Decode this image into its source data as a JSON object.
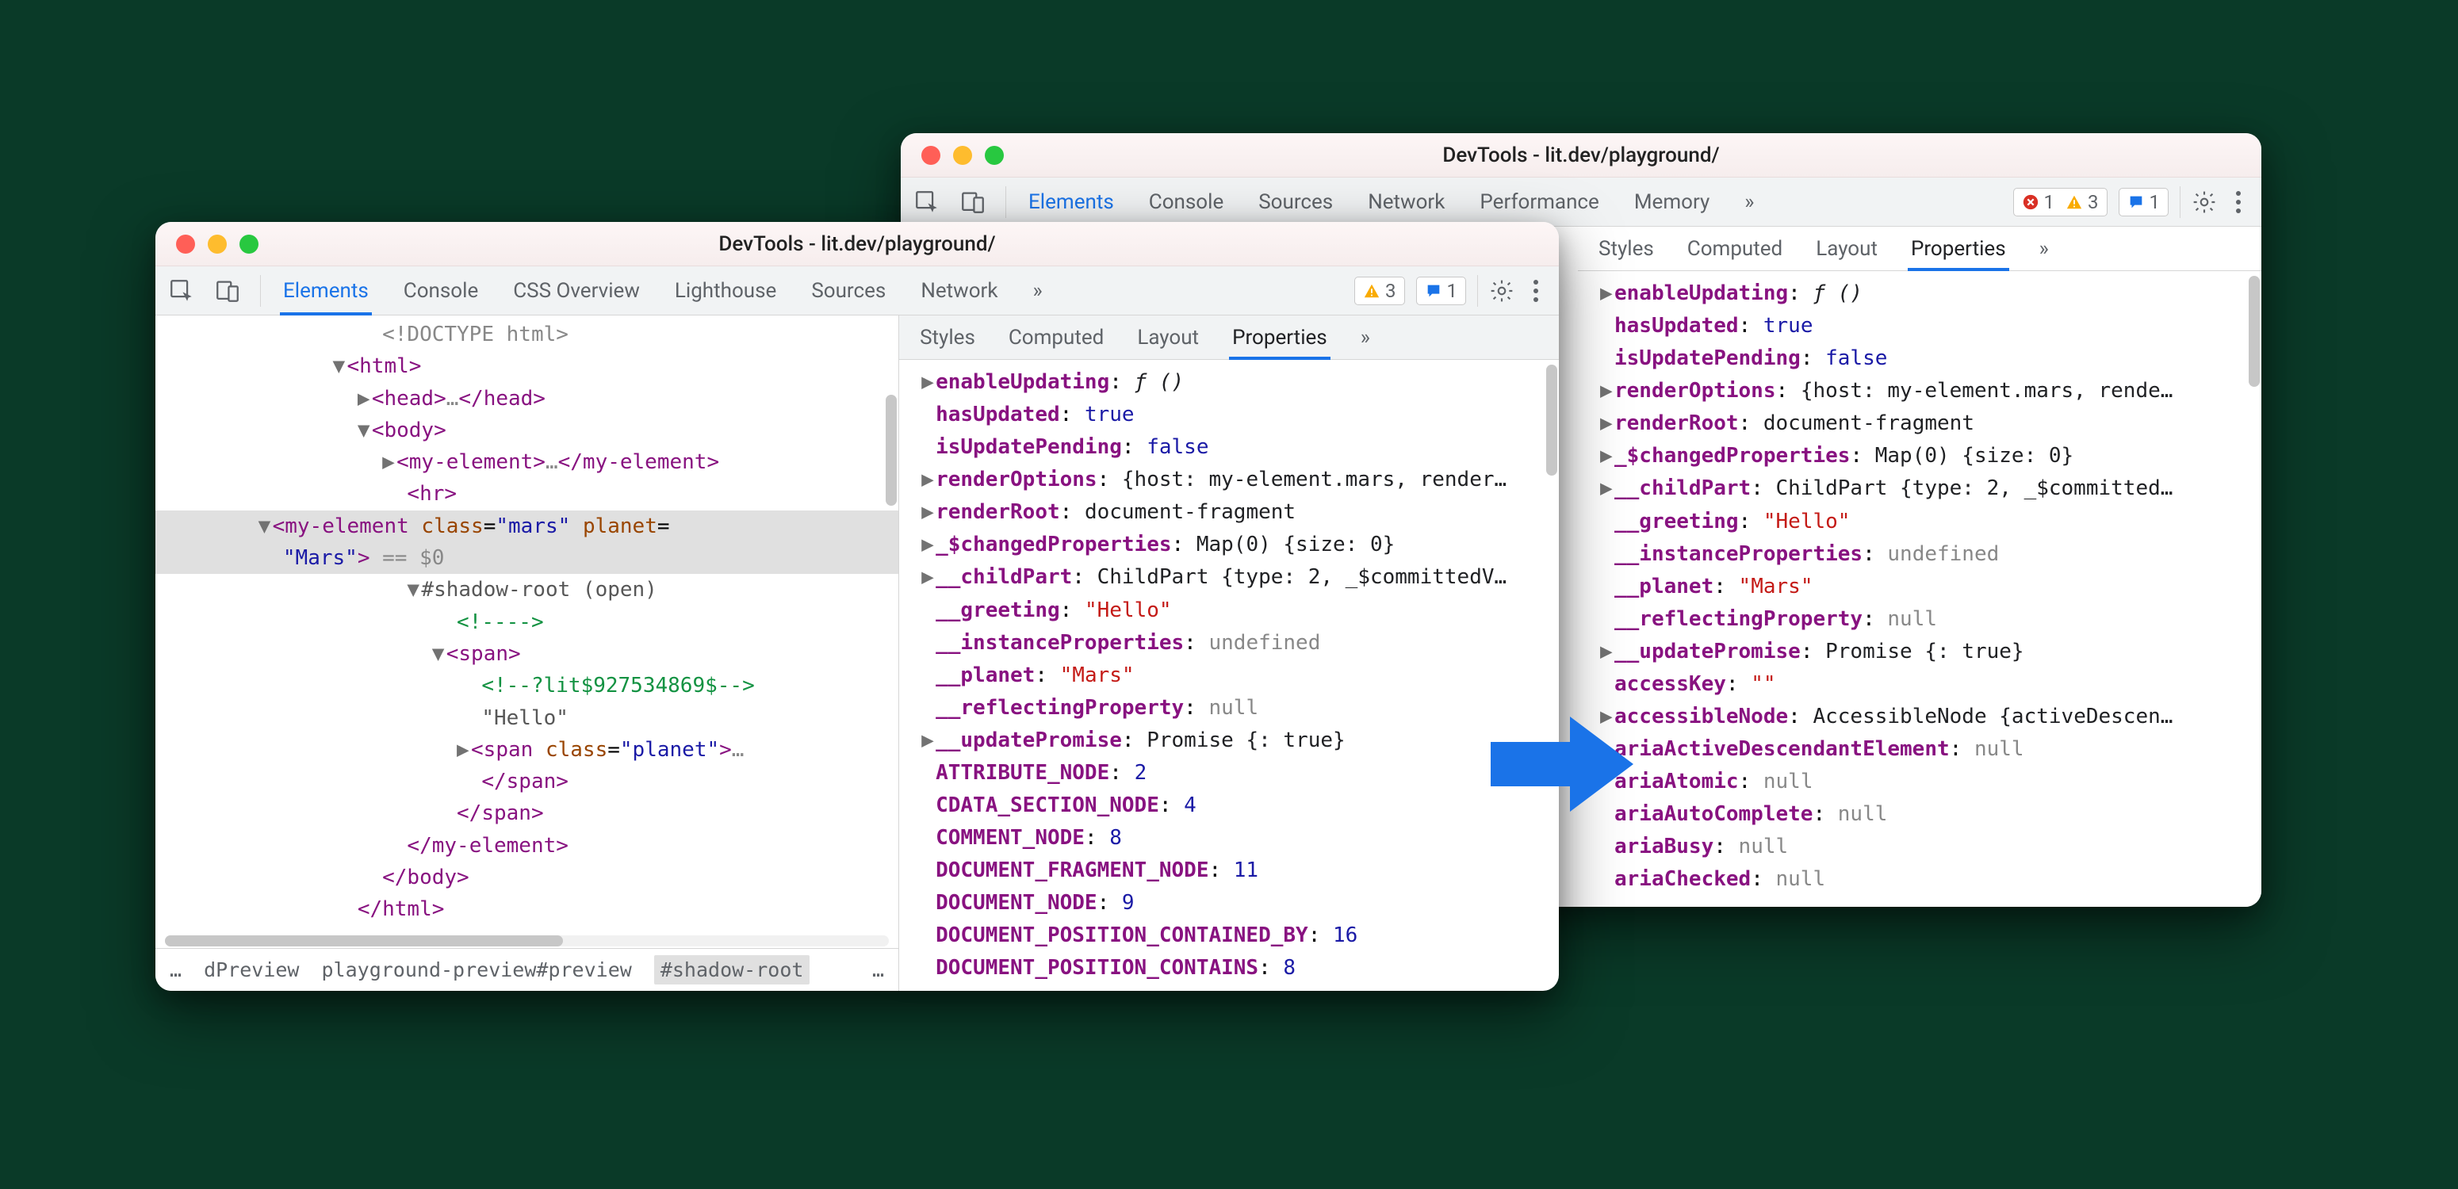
{
  "windowA": {
    "title": "DevTools - lit.dev/playground/",
    "tabs": [
      "Elements",
      "Console",
      "CSS Overview",
      "Lighthouse",
      "Sources",
      "Network"
    ],
    "activeTab": "Elements",
    "warnBadge": "3",
    "msgBadge": "1",
    "dom": {
      "doctype": "<!DOCTYPE html>",
      "html_open": "<html>",
      "head": "<head>…</head>",
      "body_open": "<body>",
      "myel_collapsed": "<my-element>…</my-element>",
      "hr": "<hr>",
      "sel_open_tag": "my-element",
      "sel_attr_class_name": "class",
      "sel_attr_class_val": "mars",
      "sel_attr_planet_name": "planet",
      "sel_attr_planet_val": "Mars",
      "sel_eq": " == $0",
      "shadow": "#shadow-root (open)",
      "lit_comment_1": "<!---->",
      "span_open": "<span>",
      "lit_comment_2": "<!--?lit$927534869$-->",
      "hello_text": "\"Hello\"",
      "span_planet": "<span class=\"planet\">…",
      "span_close": "</span>",
      "span_close_2": "</span>",
      "myel_close": "</my-element>",
      "body_close": "</body>",
      "html_close": "</html>"
    },
    "breadcrumb": {
      "a": "dPreview",
      "b": "playground-preview#preview",
      "c": "#shadow-root"
    },
    "subtabs": [
      "Styles",
      "Computed",
      "Layout",
      "Properties"
    ],
    "activeSubtab": "Properties",
    "props": [
      {
        "k": "enableUpdating",
        "v": "ƒ ()",
        "t": "fn",
        "tri": true
      },
      {
        "k": "hasUpdated",
        "v": "true",
        "t": "true"
      },
      {
        "k": "isUpdatePending",
        "v": "false",
        "t": "false"
      },
      {
        "k": "renderOptions",
        "v": "{host: my-element.mars, render…",
        "t": "obj",
        "tri": true
      },
      {
        "k": "renderRoot",
        "v": "document-fragment",
        "t": "obj",
        "tri": true
      },
      {
        "k": "_$changedProperties",
        "v": "Map(0) {size: 0}",
        "t": "obj",
        "tri": true
      },
      {
        "k": "__childPart",
        "v": "ChildPart {type: 2, _$committedV…",
        "t": "obj",
        "tri": true
      },
      {
        "k": "__greeting",
        "v": "\"Hello\"",
        "t": "str"
      },
      {
        "k": "__instanceProperties",
        "v": "undefined",
        "t": "undef"
      },
      {
        "k": "__planet",
        "v": "\"Mars\"",
        "t": "str"
      },
      {
        "k": "__reflectingProperty",
        "v": "null",
        "t": "null"
      },
      {
        "k": "__updatePromise",
        "v": "Promise {<fulfilled>: true}",
        "t": "obj",
        "tri": true
      },
      {
        "k": "ATTRIBUTE_NODE",
        "v": "2",
        "t": "num"
      },
      {
        "k": "CDATA_SECTION_NODE",
        "v": "4",
        "t": "num"
      },
      {
        "k": "COMMENT_NODE",
        "v": "8",
        "t": "num"
      },
      {
        "k": "DOCUMENT_FRAGMENT_NODE",
        "v": "11",
        "t": "num"
      },
      {
        "k": "DOCUMENT_NODE",
        "v": "9",
        "t": "num"
      },
      {
        "k": "DOCUMENT_POSITION_CONTAINED_BY",
        "v": "16",
        "t": "num"
      },
      {
        "k": "DOCUMENT_POSITION_CONTAINS",
        "v": "8",
        "t": "num"
      }
    ]
  },
  "windowB": {
    "title": "DevTools - lit.dev/playground/",
    "tabs": [
      "Elements",
      "Console",
      "Sources",
      "Network",
      "Performance",
      "Memory"
    ],
    "activeTab": "Elements",
    "errBadge": "1",
    "warnBadge": "3",
    "msgBadge": "1",
    "subtabs": [
      "Styles",
      "Computed",
      "Layout",
      "Properties"
    ],
    "activeSubtab": "Properties",
    "props": [
      {
        "k": "enableUpdating",
        "v": "ƒ ()",
        "t": "fn",
        "tri": true
      },
      {
        "k": "hasUpdated",
        "v": "true",
        "t": "true"
      },
      {
        "k": "isUpdatePending",
        "v": "false",
        "t": "false"
      },
      {
        "k": "renderOptions",
        "v": "{host: my-element.mars, rende…",
        "t": "obj",
        "tri": true
      },
      {
        "k": "renderRoot",
        "v": "document-fragment",
        "t": "obj",
        "tri": true
      },
      {
        "k": "_$changedProperties",
        "v": "Map(0) {size: 0}",
        "t": "obj",
        "tri": true
      },
      {
        "k": "__childPart",
        "v": "ChildPart {type: 2, _$committed…",
        "t": "obj",
        "tri": true
      },
      {
        "k": "__greeting",
        "v": "\"Hello\"",
        "t": "str"
      },
      {
        "k": "__instanceProperties",
        "v": "undefined",
        "t": "undef"
      },
      {
        "k": "__planet",
        "v": "\"Mars\"",
        "t": "str"
      },
      {
        "k": "__reflectingProperty",
        "v": "null",
        "t": "null"
      },
      {
        "k": "__updatePromise",
        "v": "Promise {<fulfilled>: true}",
        "t": "obj",
        "tri": true
      },
      {
        "k": "accessKey",
        "v": "\"\"",
        "t": "str"
      },
      {
        "k": "accessibleNode",
        "v": "AccessibleNode {activeDescen…",
        "t": "obj",
        "tri": true
      },
      {
        "k": "ariaActiveDescendantElement",
        "v": "null",
        "t": "null"
      },
      {
        "k": "ariaAtomic",
        "v": "null",
        "t": "null"
      },
      {
        "k": "ariaAutoComplete",
        "v": "null",
        "t": "null"
      },
      {
        "k": "ariaBusy",
        "v": "null",
        "t": "null"
      },
      {
        "k": "ariaChecked",
        "v": "null",
        "t": "null"
      }
    ]
  }
}
